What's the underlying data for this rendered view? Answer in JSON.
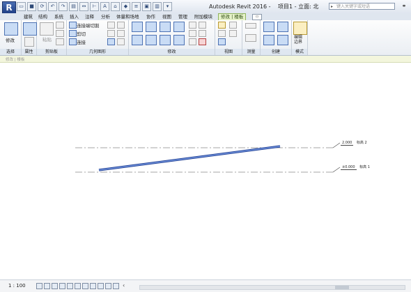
{
  "titlebar": {
    "app_button": "R",
    "app": "Autodesk Revit 2016 -",
    "doc": "项目1 - 立面: 北",
    "search_placeholder": "键入关键字或短语"
  },
  "tabs": [
    {
      "label": "建筑"
    },
    {
      "label": "结构"
    },
    {
      "label": "系统"
    },
    {
      "label": "插入"
    },
    {
      "label": "注释"
    },
    {
      "label": "分析"
    },
    {
      "label": "体量和场地"
    },
    {
      "label": "协作"
    },
    {
      "label": "视图"
    },
    {
      "label": "管理"
    },
    {
      "label": "附加模块"
    },
    {
      "label": "修改 | 楼板"
    }
  ],
  "ribbon": {
    "modify_label": "修改",
    "paste_label": "粘贴",
    "join_label": "连接端切割",
    "cut_label": "剪切",
    "connect_label": "连接",
    "edit_boundary_label": "编辑\n边界",
    "panels": {
      "select": "选择",
      "properties": "属性",
      "clipboard": "剪贴板",
      "geometry": "几何图形",
      "modify": "修改",
      "view": "视图",
      "measure": "测量",
      "create": "创建",
      "mode": "模式"
    }
  },
  "options_bar": "修改 | 楼板",
  "levels": [
    {
      "value": "2.000",
      "name": "标高 2"
    },
    {
      "value": "±0.000",
      "name": "标高 1"
    }
  ],
  "status": {
    "scale": "1 : 100"
  },
  "colors": {
    "accent": "#2f55b7",
    "active_tab": "#e6f2c9"
  }
}
